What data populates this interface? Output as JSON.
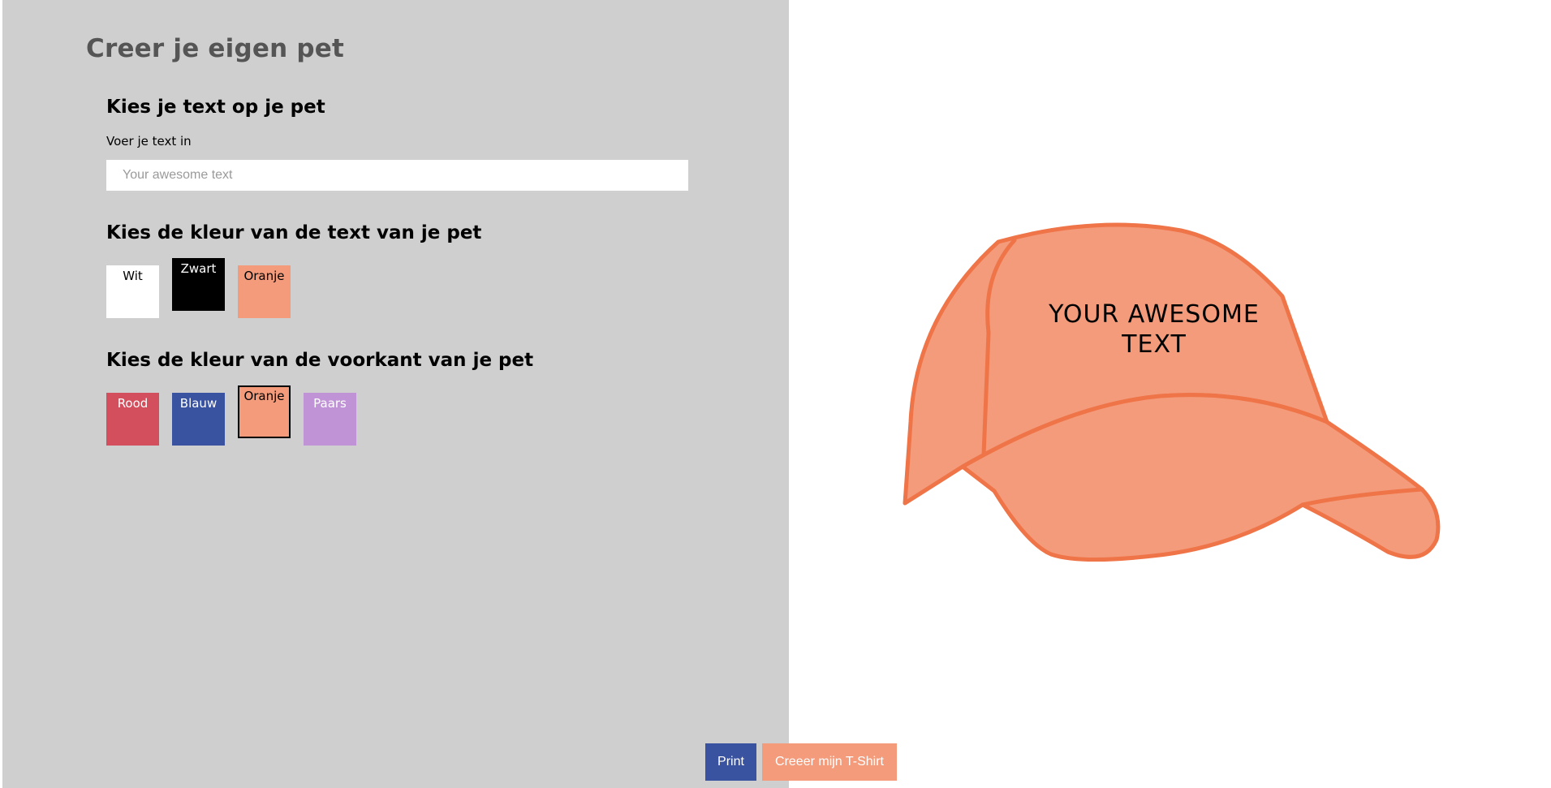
{
  "page": {
    "title": "Creer je eigen pet"
  },
  "text_section": {
    "title": "Kies je text op je pet",
    "input_label": "Voer je text in",
    "input_placeholder": "Your awesome text",
    "input_value": ""
  },
  "text_color_section": {
    "title": "Kies de kleur van de text van je pet",
    "options": [
      {
        "label": "Wit",
        "color": "#ffffff",
        "text_color": "#000000",
        "selected": false
      },
      {
        "label": "Zwart",
        "color": "#000000",
        "text_color": "#ffffff",
        "selected": true
      },
      {
        "label": "Oranje",
        "color": "#f39b7b",
        "text_color": "#000000",
        "selected": false
      }
    ]
  },
  "front_color_section": {
    "title": "Kies de kleur van de voorkant van je pet",
    "options": [
      {
        "label": "Rood",
        "color": "#d34f5d",
        "text_color": "#ffffff",
        "selected": false
      },
      {
        "label": "Blauw",
        "color": "#3a53a0",
        "text_color": "#ffffff",
        "selected": false
      },
      {
        "label": "Oranje",
        "color": "#f39b7b",
        "text_color": "#000000",
        "selected": true
      },
      {
        "label": "Paars",
        "color": "#c093d6",
        "text_color": "#ffffff",
        "selected": false
      }
    ]
  },
  "cap_preview": {
    "text_line1": "YOUR AWESOME",
    "text_line2": "TEXT",
    "fill_color": "#f39b7b",
    "outline_color": "#ef7448",
    "text_color": "#000000"
  },
  "buttons": {
    "print_label": "Print",
    "print_color": "#3a53a0",
    "tshirt_label": "Creeer mijn T-Shirt",
    "tshirt_color": "#f39b7b"
  }
}
